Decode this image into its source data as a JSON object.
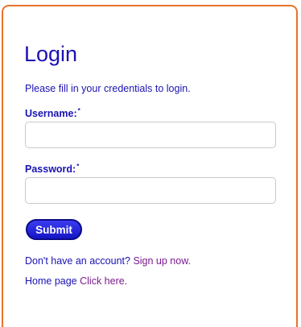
{
  "form": {
    "title": "Login",
    "subtitle": "Please fill in your credentials to login.",
    "username": {
      "label": "Username:",
      "required_mark": "*",
      "value": "",
      "placeholder": ""
    },
    "password": {
      "label": "Password:",
      "required_mark": "*",
      "value": "",
      "placeholder": ""
    },
    "submit_label": "Submit",
    "signup_prompt": "Don't have an account?",
    "signup_link": "Sign up now.",
    "home_prompt": "Home page",
    "home_link": "Click here."
  },
  "colors": {
    "border_accent": "#e8732a",
    "text": "#1a12b3",
    "link": "#7a1a8e",
    "button": "#2424e0"
  }
}
